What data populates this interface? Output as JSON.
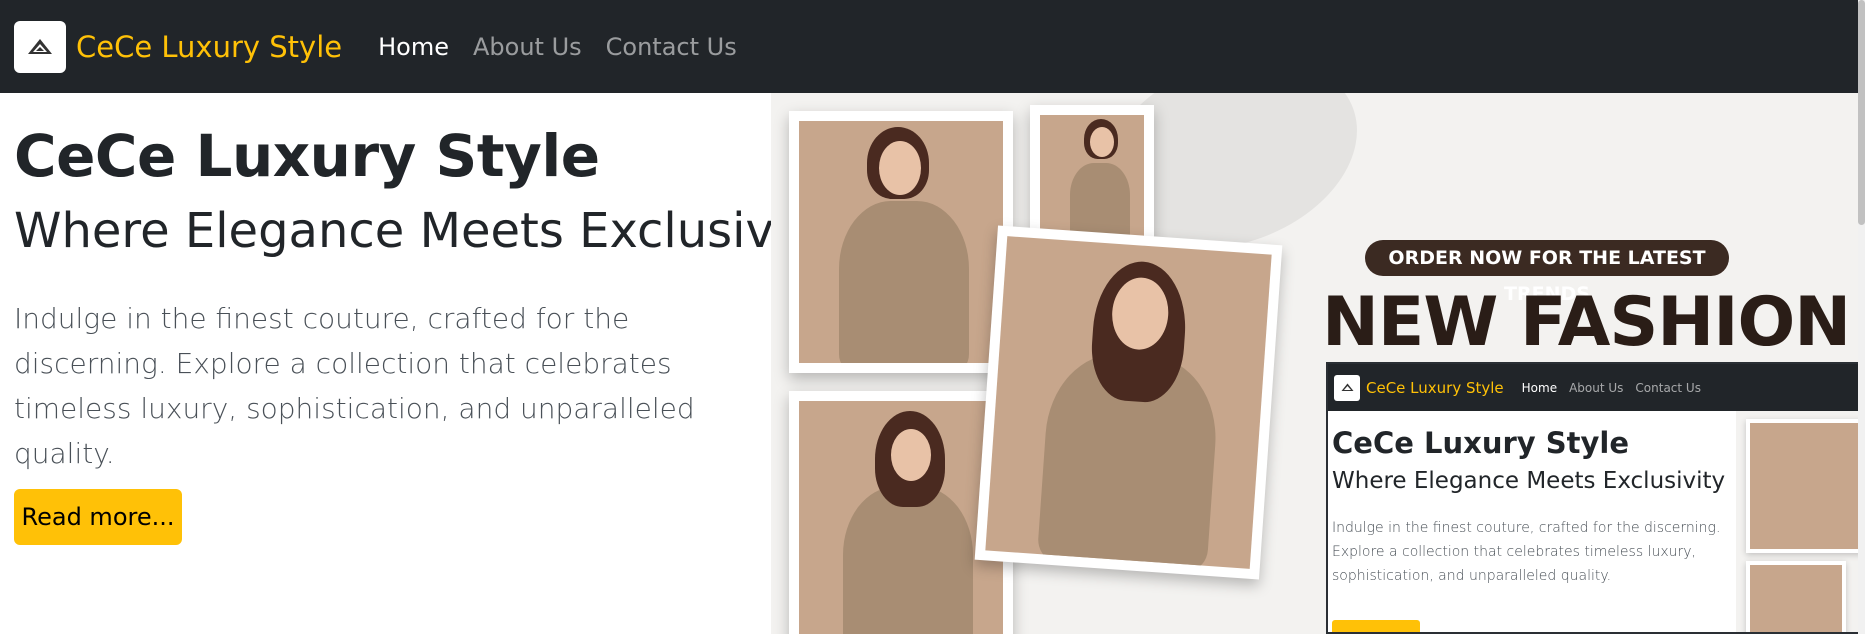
{
  "navbar": {
    "brand": "CeCe Luxury Style",
    "logo_icon": "triangle-logo-icon",
    "links": [
      {
        "label": "Home",
        "active": true
      },
      {
        "label": "About Us",
        "active": false
      },
      {
        "label": "Contact Us",
        "active": false
      }
    ]
  },
  "hero": {
    "title": "CeCe Luxury Style",
    "subtitle": "Where Elegance Meets Exclusivity",
    "description": "Indulge in the finest couture, crafted for the discerning. Explore a collection that celebrates timeless luxury, sophistication, and unparalleled quality.",
    "button_label": "Read more..."
  },
  "banner": {
    "pill_text": "ORDER NOW FOR THE LATEST TRENDS",
    "headline": "NEW FASHION"
  },
  "preview": {
    "brand": "CeCe Luxury Style",
    "links": [
      "Home",
      "About Us",
      "Contact Us"
    ],
    "title": "CeCe Luxury Style",
    "subtitle": "Where Elegance Meets Exclusivity",
    "description": "Indulge in the finest couture, crafted for the discerning. Explore a collection that celebrates timeless luxury, sophistication, and unparalleled quality."
  },
  "colors": {
    "navbar_bg": "#212529",
    "brand_accent": "#ffc107",
    "button_bg": "#ffc107"
  }
}
